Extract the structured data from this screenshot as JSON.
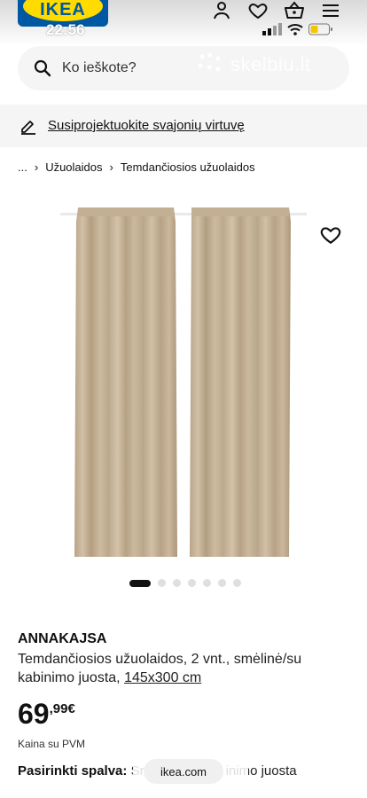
{
  "status_bar": {
    "time": "22:56"
  },
  "header": {
    "logo_text": "IKEA",
    "search_placeholder": "Ko ieškote?",
    "watermark": "skelbiu.lt"
  },
  "promo": {
    "text": "Susiprojektuokite svajonių virtuvę"
  },
  "breadcrumb": {
    "items": [
      "...",
      "Užuolaidos",
      "Temdančiosios užuolaidos"
    ]
  },
  "gallery": {
    "image_count": 7,
    "active_index": 0
  },
  "product": {
    "name": "ANNAKAJSA",
    "description": "Temdančiosios užuolaidos, 2 vnt., smėlinė/su kabinimo juosta,",
    "size": "145x300 cm",
    "price_int": "69",
    "price_dec": ",99€",
    "vat_note": "Kaina su PVM",
    "color_label": "Pasirinkti spalva:",
    "color_value_start": "Sr",
    "color_value_end": "inimo juosta"
  },
  "browser": {
    "domain": "ikea.com"
  },
  "colors": {
    "ikea_blue": "#0058a3",
    "ikea_yellow": "#ffdb00",
    "curtain_beige": "#c7b49a"
  }
}
